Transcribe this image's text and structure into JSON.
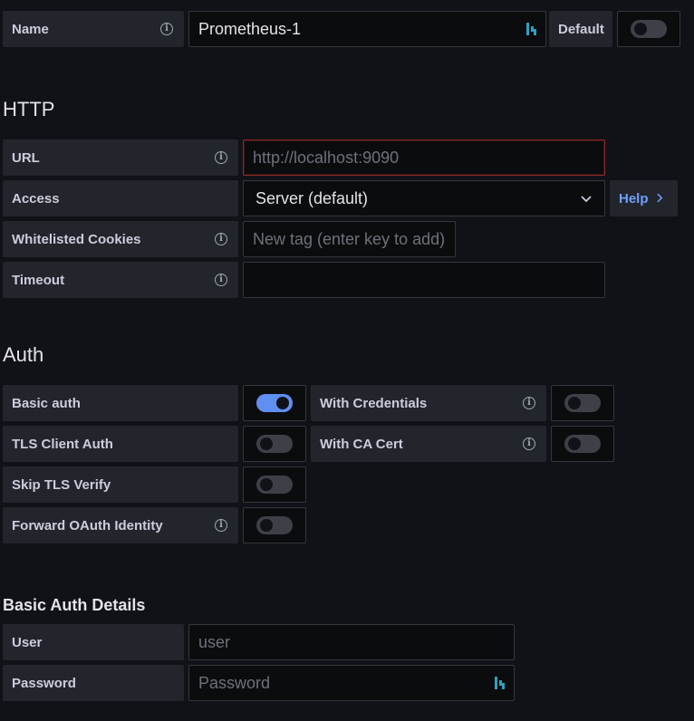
{
  "name_row": {
    "label": "Name",
    "value": "Prometheus-1",
    "default_label": "Default",
    "default_on": false
  },
  "http": {
    "title": "HTTP",
    "url": {
      "label": "URL",
      "placeholder": "http://localhost:9090"
    },
    "access": {
      "label": "Access",
      "value": "Server (default)",
      "help_label": "Help"
    },
    "cookies": {
      "label": "Whitelisted Cookies",
      "placeholder": "New tag (enter key to add)"
    },
    "timeout": {
      "label": "Timeout",
      "value": ""
    }
  },
  "auth": {
    "title": "Auth",
    "basic_auth": {
      "label": "Basic auth",
      "on": true
    },
    "with_credentials": {
      "label": "With Credentials",
      "on": false
    },
    "tls_client_auth": {
      "label": "TLS Client Auth",
      "on": false
    },
    "with_ca_cert": {
      "label": "With CA Cert",
      "on": false
    },
    "skip_tls_verify": {
      "label": "Skip TLS Verify",
      "on": false
    },
    "forward_oauth": {
      "label": "Forward OAuth Identity",
      "on": false
    }
  },
  "basic_auth_details": {
    "title": "Basic Auth Details",
    "user": {
      "label": "User",
      "placeholder": "user"
    },
    "password": {
      "label": "Password",
      "placeholder": "Password"
    }
  },
  "colors": {
    "accent": "#5f8ff0",
    "url_error_border": "#8b2a27",
    "help_text": "#6e9fff"
  }
}
